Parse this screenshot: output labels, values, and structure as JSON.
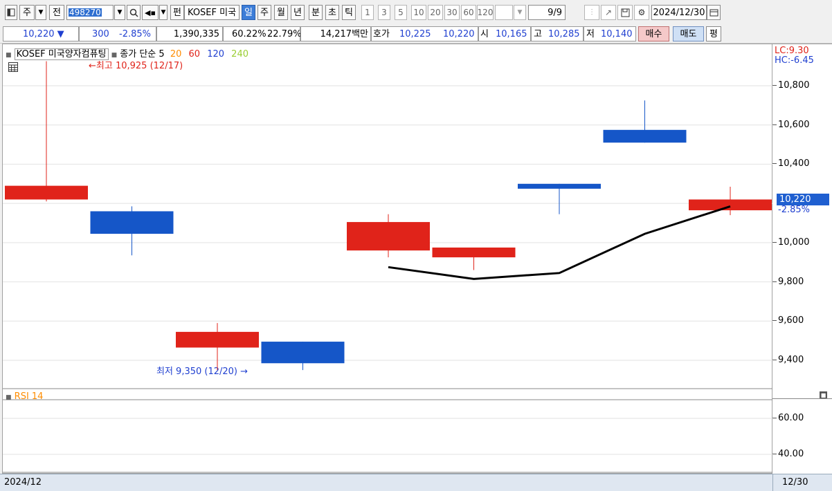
{
  "toolbar": {
    "market": "주",
    "prev": "전",
    "code": "498270",
    "type_badge": "펀",
    "name": "KOSEF 미국",
    "periods": [
      "일",
      "주",
      "월",
      "년",
      "분",
      "초",
      "틱"
    ],
    "selected_period": "일",
    "intervals": [
      "1",
      "3",
      "5",
      "10",
      "20",
      "30",
      "60",
      "120"
    ],
    "count": "9/9",
    "date": "2024/12/30"
  },
  "quote": {
    "price": "10,220 ▼",
    "change": "300",
    "change_rate": "-2.85%",
    "volume": "1,390,335",
    "ratio1": "60.22%",
    "ratio2": "22.79%",
    "amount": "14,217백만",
    "ask_label": "호가",
    "ask1": "10,225",
    "ask2": "10,220",
    "open_label": "시",
    "open": "10,165",
    "high_label": "고",
    "high": "10,285",
    "low_label": "저",
    "low": "10,140",
    "buy": "매수",
    "sell": "매도",
    "flat": "평"
  },
  "chart": {
    "legend_title": "KOSEF 미국양자컴퓨팅",
    "legend_type": "종가 단순 5",
    "ma": [
      {
        "label": "20",
        "color": "#ff8c00"
      },
      {
        "label": "60",
        "color": "#e0231a"
      },
      {
        "label": "120",
        "color": "#1f3fd0"
      },
      {
        "label": "240",
        "color": "#9acd32"
      }
    ],
    "high_marker": "최고 10,925 (12/17)",
    "low_marker": "최저 9,350 (12/20)",
    "lc_label": "LC:9.30",
    "hc_label": "HC:-6.45",
    "current_price_label": "10,220",
    "current_change_label": "-2.85%",
    "rsi_label": "RSI 14",
    "bottom_left_date": "2024/12",
    "bottom_right_date": "12/30",
    "up_color": "#e0231a",
    "down_color": "#1556c8",
    "ma_color": "#000000"
  },
  "chart_data": {
    "type": "candlestick",
    "candles": [
      {
        "open": 10220,
        "close": 10290,
        "high": 10925,
        "low": 10210
      },
      {
        "open": 10160,
        "close": 10045,
        "high": 10185,
        "low": 9935
      },
      {
        "open": 9465,
        "close": 9545,
        "high": 9590,
        "low": 9350
      },
      {
        "open": 9495,
        "close": 9385,
        "high": 9495,
        "low": 9350
      },
      {
        "open": 9960,
        "close": 10105,
        "high": 10145,
        "low": 9925
      },
      {
        "open": 9925,
        "close": 9975,
        "high": 9975,
        "low": 9860
      },
      {
        "open": 10300,
        "close": 10275,
        "high": 10300,
        "low": 10145
      },
      {
        "open": 10575,
        "close": 10510,
        "high": 10725,
        "low": 10510
      },
      {
        "open": 10165,
        "close": 10220,
        "high": 10285,
        "low": 10140
      }
    ],
    "ma5": [
      null,
      null,
      null,
      null,
      9875,
      9815,
      9845,
      10045,
      10185
    ],
    "y_ticks": [
      "10,800",
      "10,600",
      "10,400",
      "10,000",
      "9,800",
      "9,600",
      "9,400"
    ],
    "rsi_ticks": [
      "60.00",
      "40.00"
    ]
  }
}
